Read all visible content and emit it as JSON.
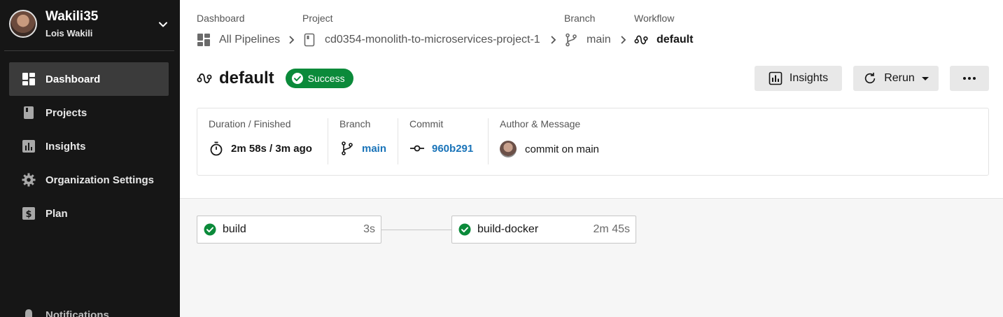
{
  "org": {
    "name": "Wakili35",
    "user": "Lois Wakili"
  },
  "sidebar": {
    "items": [
      {
        "label": "Dashboard",
        "icon": "dashboard-icon",
        "active": true
      },
      {
        "label": "Projects",
        "icon": "book-icon"
      },
      {
        "label": "Insights",
        "icon": "insights-icon"
      },
      {
        "label": "Organization Settings",
        "icon": "gear-icon"
      },
      {
        "label": "Plan",
        "icon": "dollar-icon"
      }
    ],
    "notifications_label": "Notifications"
  },
  "breadcrumb": {
    "dashboard": {
      "title": "Dashboard",
      "value": "All Pipelines"
    },
    "project": {
      "title": "Project",
      "value": "cd0354-monolith-to-microservices-project-1"
    },
    "branch": {
      "title": "Branch",
      "value": "main"
    },
    "workflow": {
      "title": "Workflow",
      "value": "default"
    }
  },
  "header": {
    "title": "default",
    "status": "Success",
    "insights_label": "Insights",
    "rerun_label": "Rerun"
  },
  "details": {
    "duration": {
      "title": "Duration / Finished",
      "value": "2m 58s / 3m ago"
    },
    "branch": {
      "title": "Branch",
      "value": "main"
    },
    "commit": {
      "title": "Commit",
      "value": "960b291"
    },
    "author": {
      "title": "Author & Message",
      "value": "commit on main"
    }
  },
  "jobs": [
    {
      "name": "build",
      "duration": "3s",
      "status": "success"
    },
    {
      "name": "build-docker",
      "duration": "2m 45s",
      "status": "success"
    }
  ],
  "colors": {
    "sidebar_bg": "#161616",
    "success": "#0b8a3a",
    "link": "#1a74b9"
  }
}
